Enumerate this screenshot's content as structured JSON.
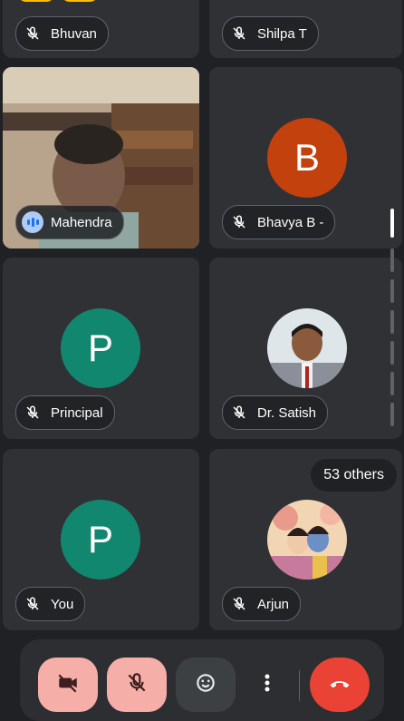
{
  "participants": [
    {
      "name": "Bhuvan",
      "mic": "muted"
    },
    {
      "name": "Shilpa T",
      "mic": "muted"
    },
    {
      "name": "Mahendra",
      "mic": "speaking"
    },
    {
      "name": "Bhavya B -",
      "mic": "muted",
      "avatar_letter": "B",
      "avatar_color": "#c2410c"
    },
    {
      "name": "Principal",
      "mic": "muted",
      "avatar_letter": "P",
      "avatar_color": "#12876f"
    },
    {
      "name": "Dr. Satish",
      "mic": "muted"
    },
    {
      "name": "You",
      "mic": "muted",
      "avatar_letter": "P",
      "avatar_color": "#12876f"
    },
    {
      "name": "Arjun",
      "mic": "muted"
    }
  ],
  "others_label": "53 others",
  "toolbar": {
    "camera": "camera-off-icon",
    "mic": "mic-off-icon",
    "reactions": "emoji-icon",
    "more": "more-vert-icon",
    "end": "end-call-icon"
  },
  "colors": {
    "active_border": "#8ab4f8",
    "end_call": "#ea4335",
    "muted_button": "#f6aea9"
  }
}
